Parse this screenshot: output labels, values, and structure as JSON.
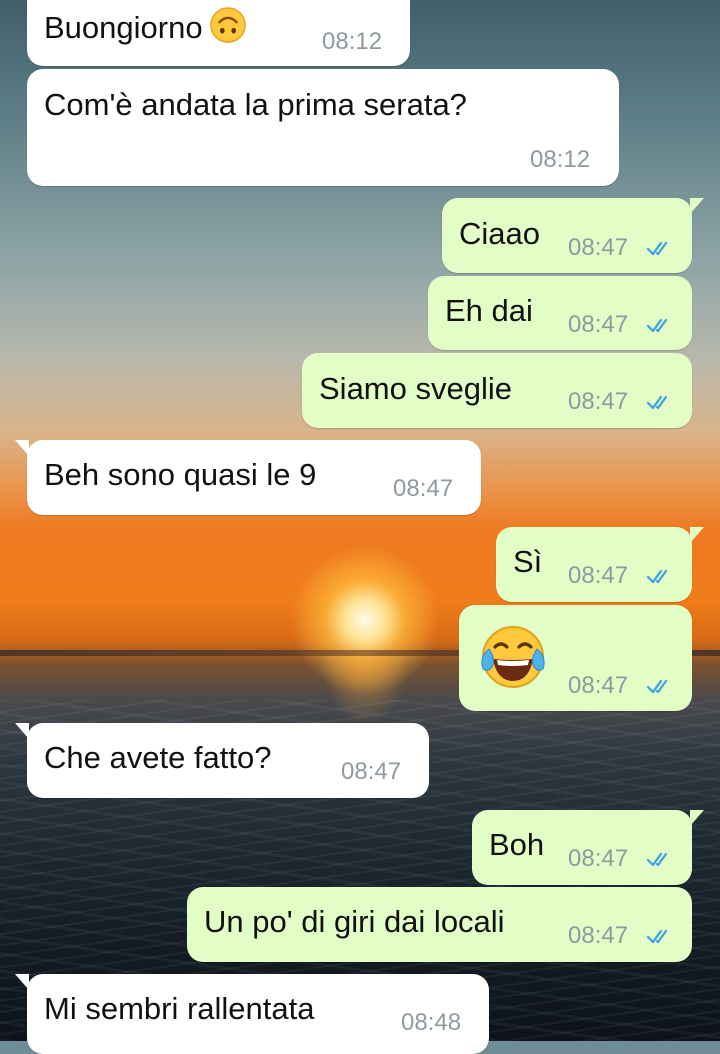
{
  "messages": [
    {
      "direction": "in",
      "text": "Buongiorno",
      "emoji": "upside-down-face",
      "time": "08:12"
    },
    {
      "direction": "in",
      "text": "Com'è andata la prima serata?",
      "time": "08:12"
    },
    {
      "direction": "out",
      "text": "Ciaao",
      "time": "08:47",
      "status": "read"
    },
    {
      "direction": "out",
      "text": "Eh dai",
      "time": "08:47",
      "status": "read"
    },
    {
      "direction": "out",
      "text": "Siamo sveglie",
      "time": "08:47",
      "status": "read"
    },
    {
      "direction": "in",
      "text": "Beh sono quasi le 9",
      "time": "08:47"
    },
    {
      "direction": "out",
      "text": "Sì",
      "time": "08:47",
      "status": "read"
    },
    {
      "direction": "out",
      "text": "",
      "emoji": "face-with-tears-of-joy",
      "time": "08:47",
      "status": "read"
    },
    {
      "direction": "in",
      "text": "Che avete fatto?",
      "time": "08:47"
    },
    {
      "direction": "out",
      "text": "Boh",
      "time": "08:47",
      "status": "read"
    },
    {
      "direction": "out",
      "text": "Un po' di giri dai locali",
      "time": "08:47",
      "status": "read"
    },
    {
      "direction": "in",
      "text": "Mi sembri rallentata",
      "time": "08:48"
    }
  ],
  "colors": {
    "incoming_bubble": "#ffffff",
    "outgoing_bubble": "#e2fdc6",
    "timestamp": "#8e9a9f",
    "read_ticks": "#3aa0e8"
  },
  "wallpaper": "sunset-over-sea"
}
